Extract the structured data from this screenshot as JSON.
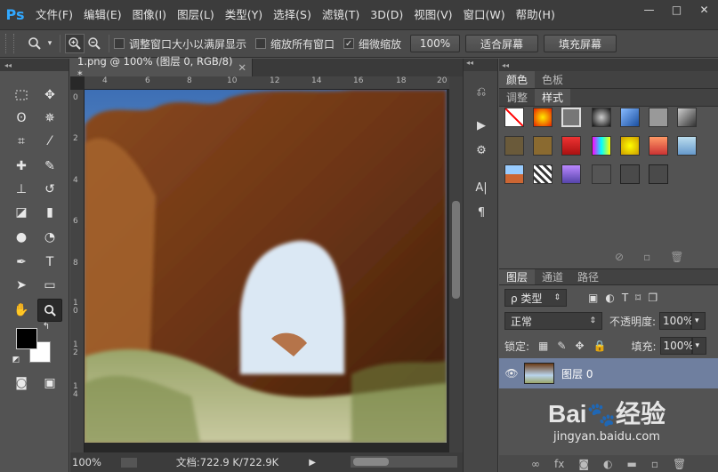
{
  "app": {
    "logo": "Ps"
  },
  "menu": [
    "文件(F)",
    "编辑(E)",
    "图像(I)",
    "图层(L)",
    "类型(Y)",
    "选择(S)",
    "滤镜(T)",
    "3D(D)",
    "视图(V)",
    "窗口(W)",
    "帮助(H)"
  ],
  "window_controls": {
    "minimize": "—",
    "maximize": "□",
    "close": "✕"
  },
  "options": {
    "resize_windows": "调整窗口大小以满屏显示",
    "zoom_all": "缩放所有窗口",
    "scrubby_zoom": "细微缩放",
    "scrubby_checked": true,
    "btn_100": "100%",
    "btn_fit": "适合屏幕",
    "btn_fill": "填充屏幕"
  },
  "document": {
    "tab_title": "1.png @ 100% (图层 0, RGB/8) *",
    "ruler_h": [
      "4",
      "6",
      "8",
      "10",
      "12",
      "14",
      "16",
      "18",
      "20"
    ],
    "ruler_v": [
      "0",
      "2",
      "4",
      "6",
      "8",
      "1\n0",
      "1\n2",
      "1\n4"
    ],
    "zoom": "100%",
    "docinfo": "文档:722.9 K/722.9K"
  },
  "panels": {
    "color_tabs": [
      "颜色",
      "色板"
    ],
    "adjust_tabs": [
      "调整",
      "样式"
    ],
    "layers_tabs": [
      "图层",
      "通道",
      "路径"
    ],
    "kind": "ρ 类型",
    "blend_mode": "正常",
    "opacity_label": "不透明度:",
    "opacity": "100%",
    "lock_label": "锁定:",
    "fill_label": "填充:",
    "fill": "100%",
    "layer_name": "图层 0"
  },
  "watermark": {
    "brand": "Bai",
    "sub": "jingyan.baidu.com",
    "text2": "经验"
  }
}
